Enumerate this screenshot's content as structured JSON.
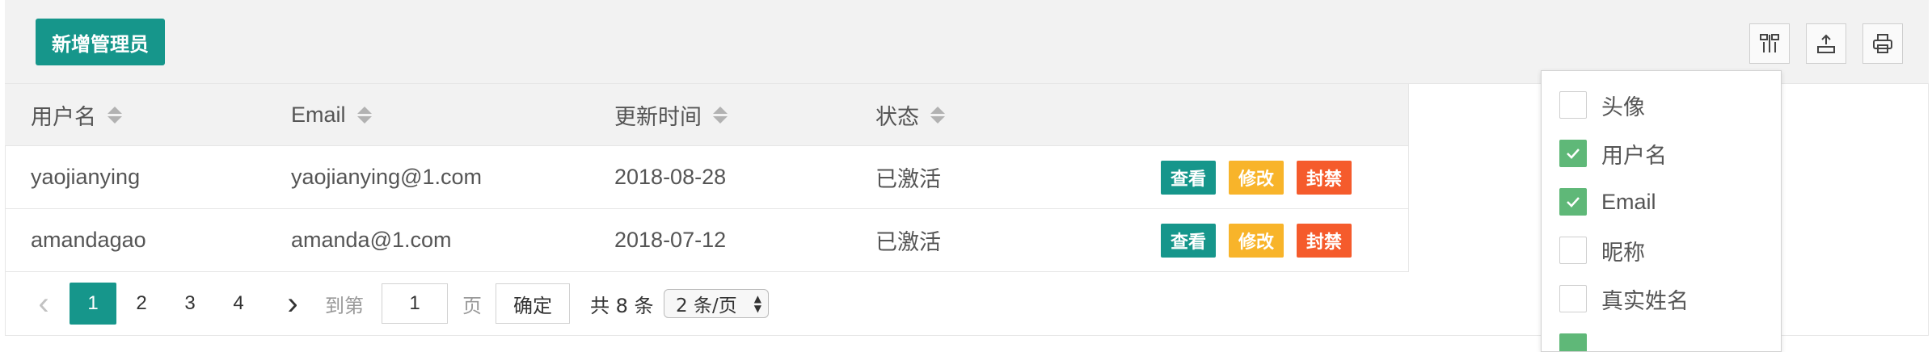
{
  "toolbar": {
    "add_label": "新增管理员",
    "icons": [
      "columns-filter-icon",
      "export-icon",
      "print-icon"
    ]
  },
  "table": {
    "headers": [
      "用户名",
      "Email",
      "更新时间",
      "状态"
    ],
    "rows": [
      {
        "username": "yaojianying",
        "email": "yaojianying@1.com",
        "updated": "2018-08-28",
        "status": "已激活"
      },
      {
        "username": "amandagao",
        "email": "amanda@1.com",
        "updated": "2018-07-12",
        "status": "已激活"
      }
    ],
    "actions": {
      "view": "查看",
      "edit": "修改",
      "ban": "封禁"
    }
  },
  "pager": {
    "prev": "‹",
    "pages": [
      "1",
      "2",
      "3",
      "4"
    ],
    "current": "1",
    "next": "›",
    "goto_prefix": "到第",
    "goto_value": "1",
    "goto_suffix": "页",
    "confirm": "确定",
    "total": "共 8 条",
    "per_page": "2 条/页"
  },
  "column_menu": {
    "items": [
      {
        "label": "头像",
        "checked": false
      },
      {
        "label": "用户名",
        "checked": true
      },
      {
        "label": "Email",
        "checked": true
      },
      {
        "label": "昵称",
        "checked": false
      },
      {
        "label": "真实姓名",
        "checked": false
      }
    ]
  },
  "colors": {
    "primary": "#16968b",
    "warning": "#f8b42a",
    "danger": "#f55b2c",
    "checked": "#5fb878"
  }
}
